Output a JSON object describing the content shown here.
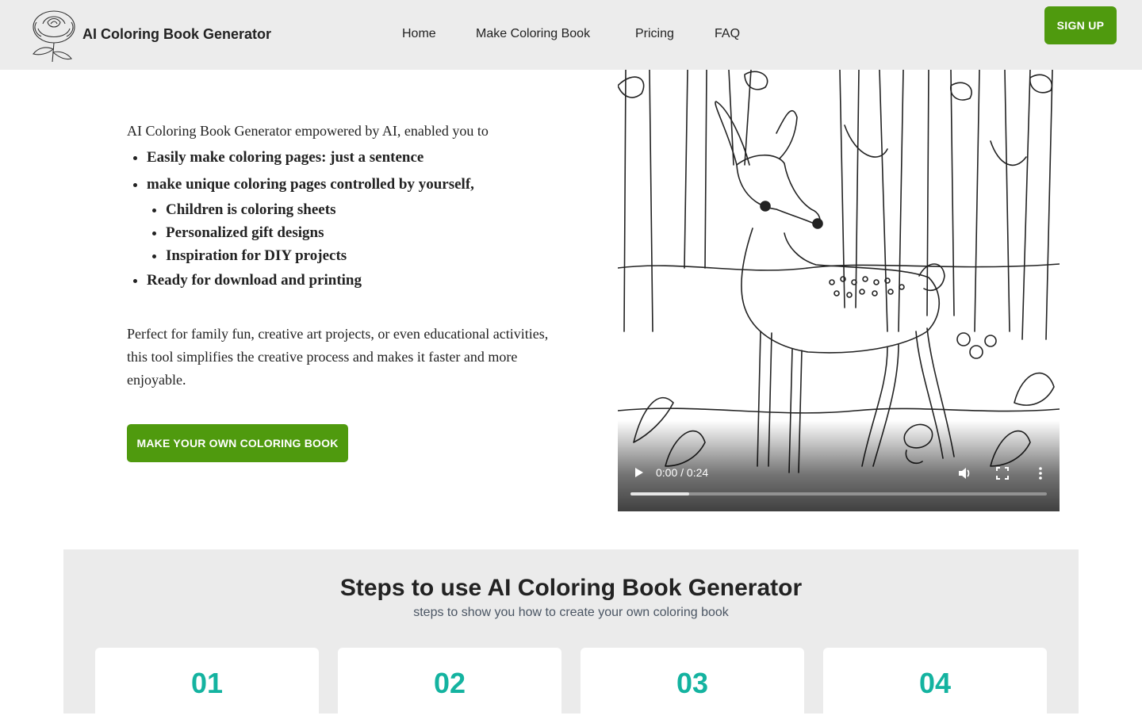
{
  "header": {
    "brand": "AI Coloring Book Generator",
    "logo_icon": "rose-logo-icon",
    "nav": [
      {
        "label": "Home"
      },
      {
        "label": "Make Coloring Book"
      },
      {
        "label": "Pricing"
      },
      {
        "label": "FAQ"
      }
    ],
    "signup_label": "SIGN UP",
    "accent_color": "#4f9a0e"
  },
  "hero": {
    "intro": "AI Coloring Book Generator empowered by AI, enabled you to",
    "features": [
      "Easily make coloring pages: just a sentence",
      "make unique coloring pages controlled by yourself,",
      "Ready for download and printing"
    ],
    "sub_features": [
      "Children is coloring sheets",
      "Personalized gift designs",
      "Inspiration for DIY projects"
    ],
    "description": "Perfect for family fun, creative art projects, or even educational activities, this tool simplifies the creative process and makes it faster and more enjoyable.",
    "cta_label": "MAKE YOUR OWN COLORING BOOK"
  },
  "video": {
    "time_display": "0:00 / 0:24",
    "buffered_fraction": 0.14,
    "play_icon": "play-icon",
    "volume_icon": "volume-icon",
    "fullscreen_icon": "fullscreen-icon",
    "more_icon": "more-vertical-icon"
  },
  "steps": {
    "title": "Steps to use AI Coloring Book Generator",
    "subtitle": "steps to show you how to create your own coloring book",
    "numbers": [
      "01",
      "02",
      "03",
      "04"
    ],
    "number_color": "#14b3a0"
  }
}
